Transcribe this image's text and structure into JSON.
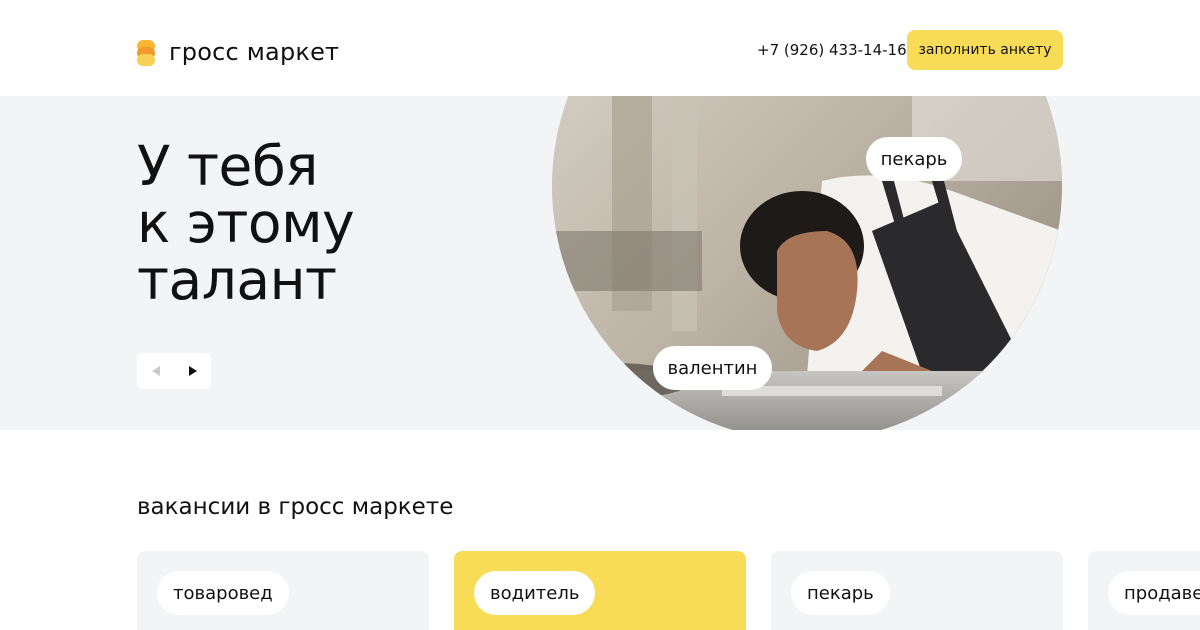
{
  "header": {
    "logo_text": "гросс маркет",
    "phone": "+7 (926) 433-14-16",
    "cta_label": "заполнить анкету"
  },
  "hero": {
    "title": "У тебя\nк этому\nталант",
    "tag_role": "пекарь",
    "tag_name": "валентин"
  },
  "vacancies": {
    "title": "вакансии в гросс маркете",
    "items": [
      {
        "label": "товаровед"
      },
      {
        "label": "водитель"
      },
      {
        "label": "пекарь"
      },
      {
        "label": "продавец"
      }
    ]
  },
  "colors": {
    "accent_yellow": "#f8dc57",
    "hero_bg": "#f3f4f6",
    "card_bg": "#f3f4f6"
  }
}
